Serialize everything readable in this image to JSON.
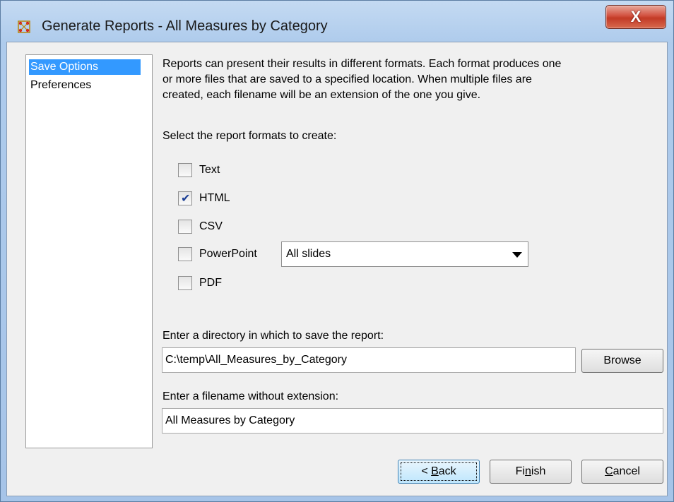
{
  "window": {
    "title": "Generate Reports - All Measures by Category",
    "close_label": "X"
  },
  "nav": {
    "items": [
      {
        "label": "Save Options",
        "selected": true
      },
      {
        "label": "Preferences",
        "selected": false
      }
    ]
  },
  "main": {
    "description_lines": [
      "Reports can present their results in different formats. Each format produces one",
      "or more files that are saved to a specified location. When multiple files are",
      "created, each filename will be an extension of the one you give."
    ],
    "formats_prompt": "Select the report formats to create:",
    "formats": [
      {
        "label": "Text",
        "checked": false
      },
      {
        "label": "HTML",
        "checked": true
      },
      {
        "label": "CSV",
        "checked": false
      },
      {
        "label": "PowerPoint",
        "checked": false
      },
      {
        "label": "PDF",
        "checked": false
      }
    ],
    "powerpoint_option": "All slides",
    "directory_prompt": "Enter a directory in which to save the report:",
    "directory_value": "C:\\temp\\All_Measures_by_Category",
    "browse_label": "Browse",
    "filename_prompt": "Enter a filename without extension:",
    "filename_value": "All Measures by Category"
  },
  "footer": {
    "back_prefix": "< ",
    "back_mnemonic": "B",
    "back_rest": "ack",
    "finish_pre": "Fi",
    "finish_mnemonic": "n",
    "finish_rest": "ish",
    "cancel_mnemonic": "C",
    "cancel_rest": "ancel"
  },
  "colors": {
    "selection": "#3399ff",
    "close_button": "#c23a26",
    "title_bar": "#aecbec"
  }
}
